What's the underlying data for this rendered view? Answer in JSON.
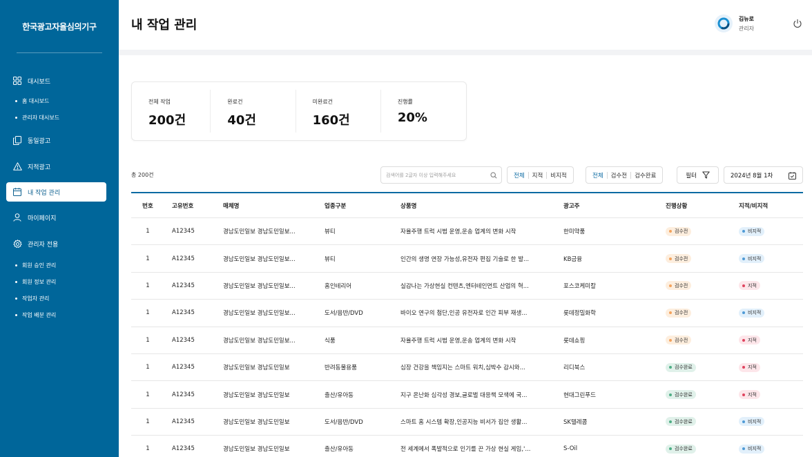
{
  "app": {
    "brand": "한국광고자율심의기구"
  },
  "sidebar": {
    "items": [
      {
        "label": "대시보드",
        "icon": "grid-icon"
      },
      {
        "label": "동일광고",
        "icon": "copy-icon"
      },
      {
        "label": "지적광고",
        "icon": "warning-icon"
      },
      {
        "label": "내 작업 관리",
        "icon": "calendar-icon",
        "active": true
      },
      {
        "label": "마이페이지",
        "icon": "user-icon"
      },
      {
        "label": "관리자 전용",
        "icon": "gear-icon"
      }
    ],
    "dashboard_sub": [
      "홈 대시보드",
      "관리자 대시보드"
    ],
    "admin_sub": [
      "회원 승인 관리",
      "회원 정보 관리",
      "작업자 관리",
      "작업 배분 관리"
    ]
  },
  "header": {
    "title": "내 작업 관리",
    "user_name": "김뉴로",
    "user_role": "관리자"
  },
  "stats": [
    {
      "label": "전체 작업",
      "value": "200건"
    },
    {
      "label": "완료건",
      "value": "40건"
    },
    {
      "label": "미완료건",
      "value": "160건"
    },
    {
      "label": "진행률",
      "value": "20%"
    }
  ],
  "toolbar": {
    "total": "총 200건",
    "search_placeholder": "검색어를 2글자 이상 입력해주세요",
    "point_filter": [
      "전체",
      "지적",
      "비지적"
    ],
    "review_filter": [
      "전체",
      "검수전",
      "검수완료"
    ],
    "filter_label": "필터",
    "date_label": "2024년 8월 1차"
  },
  "table": {
    "columns": [
      "번호",
      "고유번호",
      "매체명",
      "업종구분",
      "상품명",
      "광고주",
      "진행상황",
      "지적/비지적"
    ],
    "rows": [
      {
        "no": "1",
        "id": "A12345",
        "media": "경남도민일보 경남도민일보...",
        "category": "뷰티",
        "product": "자율주행 트럭 시범 운영,운송 업계의 변화 시작",
        "advertiser": "한미약품",
        "status": "검수전",
        "point": "비지적"
      },
      {
        "no": "1",
        "id": "A12345",
        "media": "경남도민일보 경남도민일보...",
        "category": "뷰티",
        "product": "인간의 생명 연장 가능성,유전자 편집 기술로 한 발...",
        "advertiser": "KB금융",
        "status": "검수전",
        "point": "비지적"
      },
      {
        "no": "1",
        "id": "A12345",
        "media": "경남도민일보 경남도민일보...",
        "category": "홈인테리어",
        "product": "실감나는 가상현실 컨텐츠,엔터테인먼트 산업의 혁...",
        "advertiser": "포스코케미칼",
        "status": "검수전",
        "point": "지적"
      },
      {
        "no": "1",
        "id": "A12345",
        "media": "경남도민일보 경남도민일보...",
        "category": "도서/음반/DVD",
        "product": "바이오 연구의 첨단,인공 유전자로 인간 피부 재생...",
        "advertiser": "롯데정밀화학",
        "status": "검수전",
        "point": "비지적"
      },
      {
        "no": "1",
        "id": "A12345",
        "media": "경남도민일보 경남도민일보...",
        "category": "식품",
        "product": "자율주행 트럭 시범 운영,운송 업계의 변화 시작",
        "advertiser": "롯데쇼핑",
        "status": "검수전",
        "point": "지적"
      },
      {
        "no": "1",
        "id": "A12345",
        "media": "경남도민일보 경남도민일보",
        "category": "반려동물용품",
        "product": "심장 건강을 책임지는 스마트 워치,심박수 감시와...",
        "advertiser": "리디북스",
        "status": "검수완료",
        "point": "지적"
      },
      {
        "no": "1",
        "id": "A12345",
        "media": "경남도민일보 경남도민일보",
        "category": "출산/유아동",
        "product": "지구 온난화 심각성 경보,글로벌 대응책 모색에 국...",
        "advertiser": "현대그린푸드",
        "status": "검수완료",
        "point": "지적"
      },
      {
        "no": "1",
        "id": "A12345",
        "media": "경남도민일보 경남도민일보",
        "category": "도서/음반/DVD",
        "product": "스마트 홈 시스템 확장,인공지능 비서가 집안 생활...",
        "advertiser": "SK텔레콤",
        "status": "검수완료",
        "point": "비지적"
      },
      {
        "no": "1",
        "id": "A12345",
        "media": "경남도민일보 경남도민일보",
        "category": "출산/유아동",
        "product": "전 세계에서 폭발적으로 인기를 끈 가상 현실 게임,'...",
        "advertiser": "S-Oil",
        "status": "검수완료",
        "point": "비지적"
      }
    ]
  },
  "colors": {
    "sidebar": "#00669a",
    "accent": "#0b6aa2",
    "pending": "#f3a35d",
    "done": "#4fae85",
    "nonpoint": "#4f9ad6",
    "point": "#e0445f"
  }
}
